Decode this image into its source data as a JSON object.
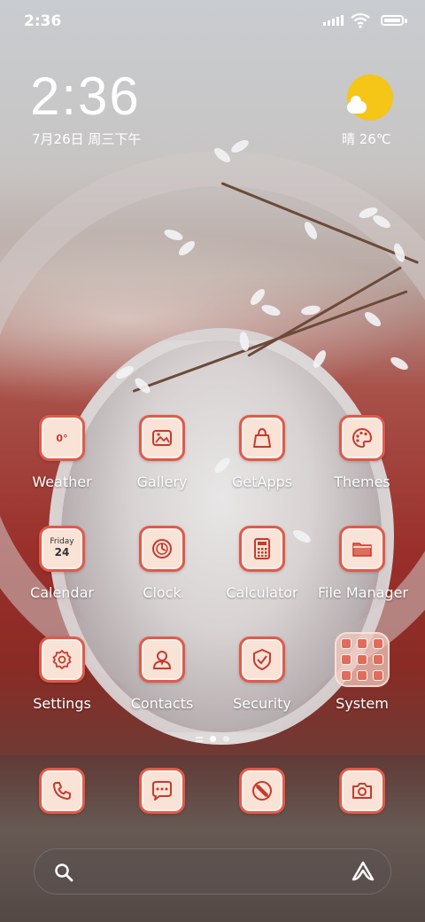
{
  "status_bar": {
    "time": "2:36",
    "signal-icon": "signal-icon",
    "wifi-icon": "wifi-icon",
    "battery-icon": "battery-icon"
  },
  "lockclock": {
    "time": "2:36",
    "date": "7月26日 周三下午"
  },
  "weather_widget": {
    "icon": "sun-cloud-icon",
    "text": "晴 26℃"
  },
  "apps": [
    {
      "label": "Weather",
      "icon": "weather-icon",
      "glyph": "0°"
    },
    {
      "label": "Gallery",
      "icon": "gallery-icon"
    },
    {
      "label": "GetApps",
      "icon": "shopping-bag-icon"
    },
    {
      "label": "Themes",
      "icon": "palette-icon"
    },
    {
      "label": "Calendar",
      "icon": "calendar-icon",
      "weekday": "Friday",
      "day": "24"
    },
    {
      "label": "Clock",
      "icon": "clock-icon"
    },
    {
      "label": "Calculator",
      "icon": "calculator-icon"
    },
    {
      "label": "File Manager",
      "icon": "folder-icon"
    },
    {
      "label": "Settings",
      "icon": "gear-icon"
    },
    {
      "label": "Contacts",
      "icon": "contact-icon"
    },
    {
      "label": "Security",
      "icon": "shield-icon"
    },
    {
      "label": "System",
      "icon": "app-folder-icon"
    }
  ],
  "dock": [
    {
      "icon": "phone-icon"
    },
    {
      "icon": "message-icon"
    },
    {
      "icon": "browser-icon"
    },
    {
      "icon": "camera-icon"
    }
  ],
  "page_indicator": {
    "pages": 2,
    "active": 1
  },
  "colors": {
    "icon_bg": "#f9e2d6",
    "icon_border": "#e05a4a",
    "sun": "#f5c518"
  }
}
